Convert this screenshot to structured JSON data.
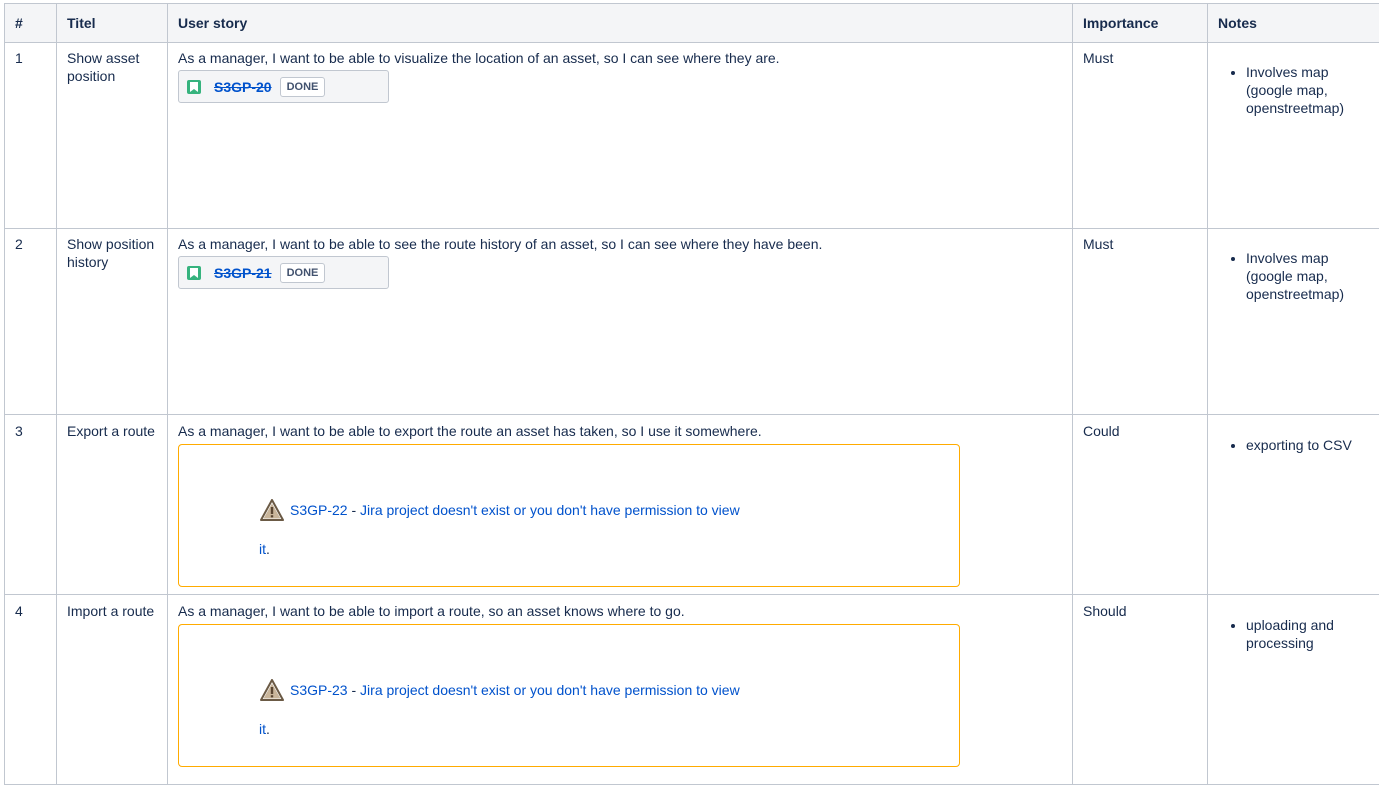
{
  "headers": {
    "num": "#",
    "title": "Titel",
    "story": "User story",
    "importance": "Importance",
    "notes": "Notes"
  },
  "rows": [
    {
      "num": "1",
      "title": "Show asset position",
      "story": "As a manager, I want to be able to visualize the location of an asset, so I can see where they are.",
      "issue_key": "S3GP-20",
      "status": "DONE",
      "importance": "Must",
      "notes": [
        "Involves map (google map, openstreetmap)"
      ]
    },
    {
      "num": "2",
      "title": "Show position history",
      "story": "As a manager, I want to be able to see the route history of an asset, so I can see where they have been.",
      "issue_key": "S3GP-21",
      "status": "DONE",
      "importance": "Must",
      "notes": [
        "Involves map (google map, openstreetmap)"
      ]
    },
    {
      "num": "3",
      "title": "Export a route",
      "story": "As a manager, I want to be able to export the route an asset has taken, so I use it somewhere.",
      "issue_key": "S3GP-22",
      "warning": "Jira project doesn't exist or you don't have permission to view",
      "warning_tail": "it",
      "separator": " - ",
      "importance": "Could",
      "notes": [
        "exporting to CSV"
      ]
    },
    {
      "num": "4",
      "title": "Import a route",
      "story": "As a manager, I want to be able to import a route, so an asset knows where to go.",
      "issue_key": "S3GP-23",
      "warning": "Jira project doesn't exist or you don't have permission to view",
      "warning_tail": "it",
      "separator": " - ",
      "importance": "Should",
      "notes": [
        "uploading and processing"
      ]
    }
  ],
  "icons": {
    "story": "story-bookmark-icon",
    "warning": "warning-triangle-icon"
  },
  "colors": {
    "border": "#c1c7d0",
    "header_bg": "#f4f5f7",
    "link": "#0052cc",
    "story_icon": "#36b37e",
    "warning_border": "#ffab00"
  }
}
